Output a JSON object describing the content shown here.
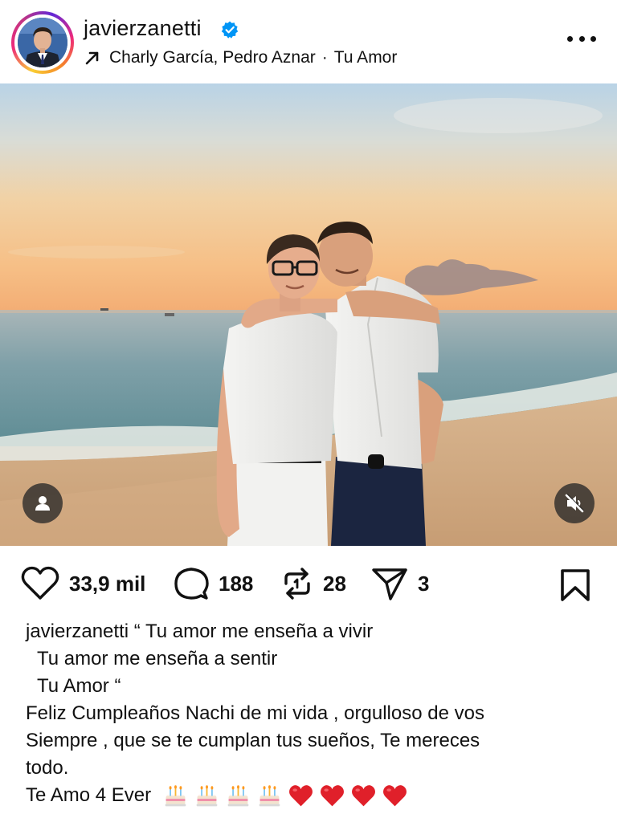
{
  "post": {
    "username": "javierzanetti",
    "verified": true,
    "music": {
      "artists": "Charly García, Pedro Aznar",
      "separator": "·",
      "song": "Tu Amor"
    }
  },
  "actions": {
    "likes": "33,9 mil",
    "comments": "188",
    "reposts": "28",
    "shares": "3"
  },
  "caption": {
    "username": "javierzanetti",
    "lines": [
      "“ Tu amor me enseña a vivir",
      "Tu amor me enseña a sentir",
      "Tu Amor “",
      "Feliz Cumpleaños Nachi de mi vida , orgulloso de vos",
      "Siempre , que se te cumplan tus sueños, Te mereces",
      "todo.",
      "Te Amo 4 Ever"
    ],
    "emojis": [
      "birthday-cake",
      "birthday-cake",
      "birthday-cake",
      "birthday-cake",
      "red-heart",
      "red-heart",
      "red-heart",
      "red-heart"
    ]
  },
  "icons": {
    "more": "more-horizontal-icon",
    "tag": "user-tag-icon",
    "mute": "speaker-muted-icon",
    "like": "heart-icon",
    "comment": "comment-bubble-icon",
    "repost": "repost-icon",
    "share": "paper-plane-icon",
    "save": "bookmark-icon"
  },
  "colors": {
    "verified_blue": "#0095f6",
    "text": "#111111",
    "heart_red": "#e0202a"
  }
}
